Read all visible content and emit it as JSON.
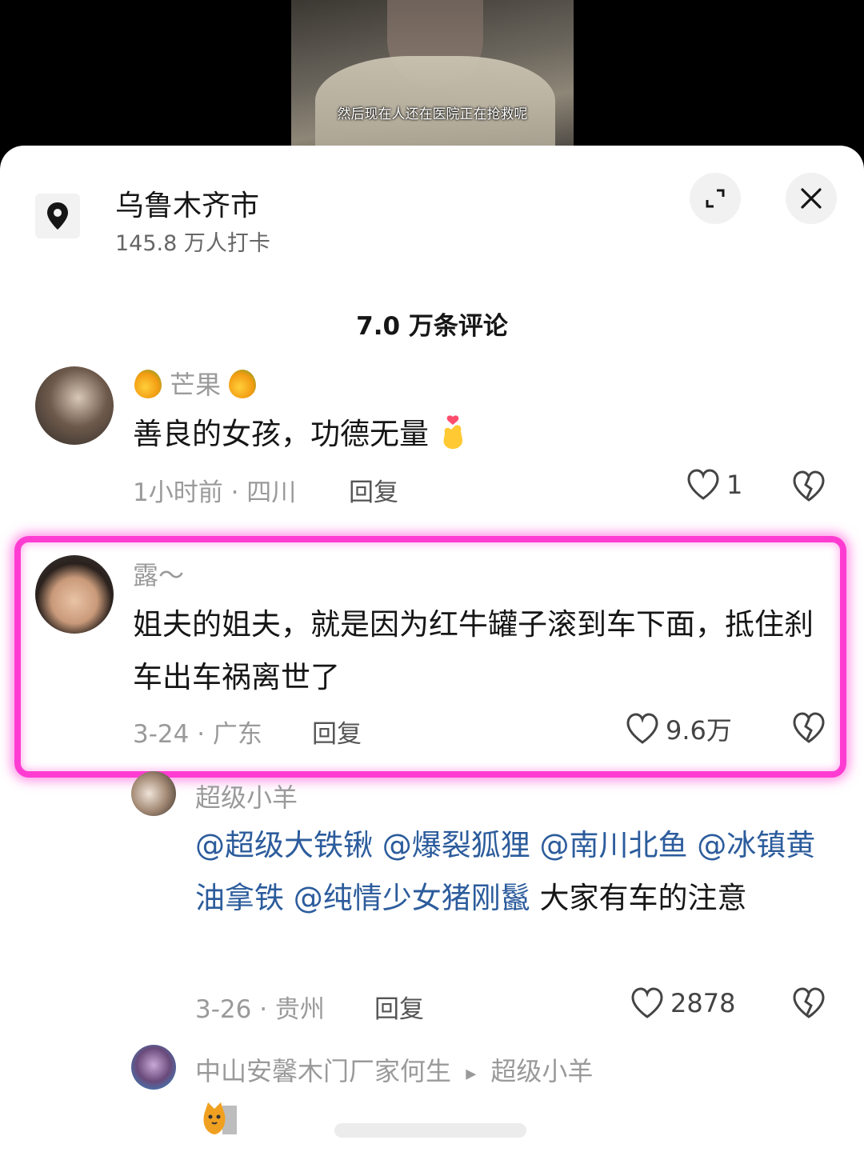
{
  "video": {
    "subtitle": "然后现在人还在医院正在抢救呢"
  },
  "location": {
    "title": "乌鲁木齐市",
    "checkins": "145.8 万人打卡",
    "icon": "location-pin-icon"
  },
  "header_buttons": {
    "expand_icon": "expand-icon",
    "close_icon": "close-icon"
  },
  "comments_count": "7.0 万条评论",
  "comments": [
    {
      "user": "芒果",
      "name_prefix_emoji": "mango-emoji",
      "name_suffix_emoji": "mango-emoji",
      "text": "善良的女孩，功德无量",
      "text_emoji": "finger-heart-emoji",
      "time_location": "1小时前 · 四川",
      "reply": "回复",
      "likes": "1"
    },
    {
      "user": "露～",
      "text": "姐夫的姐夫，就是因为红牛罐子滚到车下面，抵住刹车出车祸离世了",
      "time_location": "3-24 · 广东",
      "reply": "回复",
      "likes": "9.6万",
      "highlighted": true,
      "highlight_color": "#ff3cd2"
    }
  ],
  "replies": [
    {
      "user": "超级小羊",
      "mentions": [
        "@超级大铁锹",
        "@爆裂狐狸",
        "@南川北鱼",
        "@冰镇黄油拿铁",
        "@纯情少女猪刚鬣"
      ],
      "text_tail": "大家有车的注意",
      "time_location": "3-26 · 贵州",
      "reply": "回复",
      "likes": "2878"
    },
    {
      "user": "中山安馨木门厂家何生",
      "reply_to": "超级小羊",
      "arrow": "▸",
      "sticker": "cat-sticker"
    }
  ],
  "colors": {
    "mention": "#2c5c9c",
    "highlight": "#ff3cd2",
    "meta": "#9a9a9a"
  }
}
